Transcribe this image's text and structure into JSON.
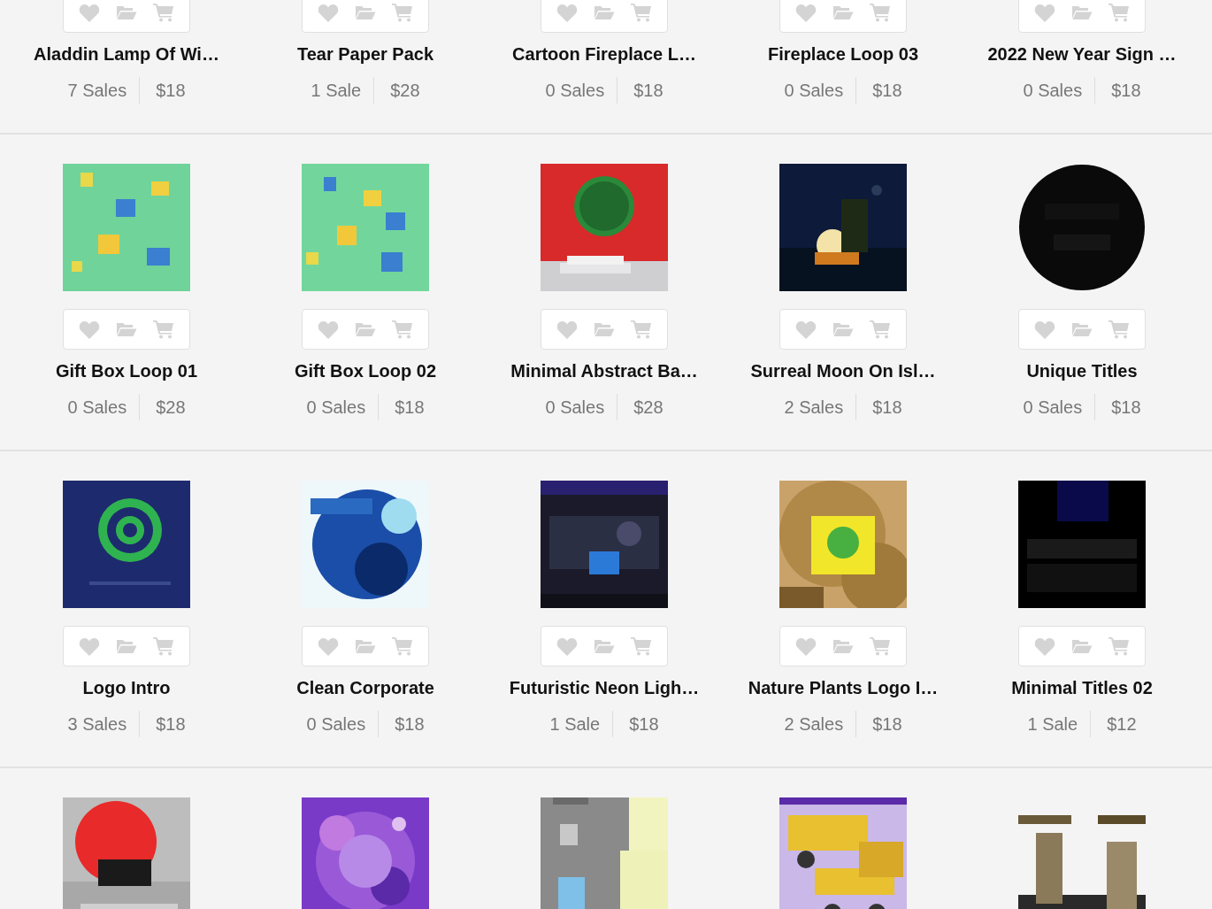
{
  "rows": [
    {
      "products": [
        {
          "title": "Aladdin Lamp Of Wi…",
          "sales": "7 Sales",
          "price": "$18"
        },
        {
          "title": "Tear Paper Pack",
          "sales": "1 Sale",
          "price": "$28"
        },
        {
          "title": "Cartoon Fireplace L…",
          "sales": "0 Sales",
          "price": "$18"
        },
        {
          "title": "Fireplace Loop 03",
          "sales": "0 Sales",
          "price": "$18"
        },
        {
          "title": "2022 New Year Sign …",
          "sales": "0 Sales",
          "price": "$18"
        }
      ]
    },
    {
      "products": [
        {
          "thumbnail": {
            "kind": "picture"
          },
          "title": "Gift Box Loop 01",
          "sales": "0 Sales",
          "price": "$28"
        },
        {
          "thumbnail": {
            "kind": "picture"
          },
          "title": "Gift Box Loop 02",
          "sales": "0 Sales",
          "price": "$18"
        },
        {
          "thumbnail": {
            "kind": "picture"
          },
          "title": "Minimal Abstract Ba…",
          "sales": "0 Sales",
          "price": "$28"
        },
        {
          "thumbnail": {
            "kind": "picture"
          },
          "title": "Surreal Moon On Isl…",
          "sales": "2 Sales",
          "price": "$18"
        },
        {
          "thumbnail": {
            "kind": "picture"
          },
          "title": "Unique Titles",
          "sales": "0 Sales",
          "price": "$18"
        }
      ]
    },
    {
      "products": [
        {
          "thumbnail": {
            "kind": "picture"
          },
          "title": "Logo Intro",
          "sales": "3 Sales",
          "price": "$18"
        },
        {
          "thumbnail": {
            "kind": "picture"
          },
          "title": "Clean Corporate",
          "sales": "0 Sales",
          "price": "$18"
        },
        {
          "thumbnail": {
            "kind": "picture"
          },
          "title": "Futuristic Neon Ligh…",
          "sales": "1 Sale",
          "price": "$18"
        },
        {
          "thumbnail": {
            "kind": "picture"
          },
          "title": "Nature Plants Logo I…",
          "sales": "2 Sales",
          "price": "$18"
        },
        {
          "thumbnail": {
            "kind": "picture"
          },
          "title": "Minimal Titles 02",
          "sales": "1 Sale",
          "price": "$12"
        }
      ]
    },
    {
      "products": [
        {
          "thumbnail": {
            "kind": "picture"
          }
        },
        {
          "thumbnail": {
            "kind": "picture"
          }
        },
        {
          "thumbnail": {
            "kind": "picture"
          }
        },
        {
          "thumbnail": {
            "kind": "picture"
          }
        },
        {
          "thumbnail": {
            "kind": "picture"
          }
        }
      ]
    }
  ]
}
